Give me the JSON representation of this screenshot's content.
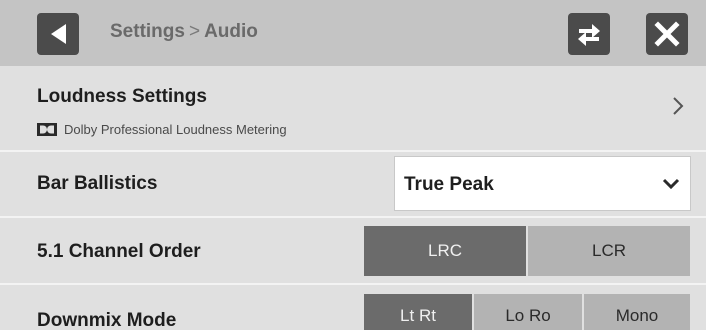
{
  "header": {
    "back_icon": "back-triangle-icon",
    "breadcrumb_parent": "Settings",
    "breadcrumb_separator": ">",
    "breadcrumb_current": "Audio",
    "swap_icon": "swap-arrows-icon",
    "close_icon": "close-x-icon"
  },
  "loudness": {
    "title": "Loudness Settings",
    "subtitle": "Dolby Professional Loudness Metering",
    "logo_icon": "dolby-logo-icon",
    "chevron_icon": "chevron-right-icon"
  },
  "bar_ballistics": {
    "label": "Bar Ballistics",
    "selected_value": "True Peak",
    "chevron_icon": "chevron-down-icon"
  },
  "channel_order": {
    "label": "5.1 Channel Order",
    "options": [
      "LRC",
      "LCR"
    ],
    "selected": "LRC"
  },
  "downmix": {
    "label": "Downmix Mode",
    "options": [
      "Lt Rt",
      "Lo Ro",
      "Mono"
    ],
    "selected": "Lt Rt"
  },
  "colors": {
    "header_bg": "#c4c4c4",
    "button_dark": "#4b4b4b",
    "row_bg": "#e0e0e0",
    "segment_selected": "#6b6b6b",
    "segment_unselected": "#b3b3b3"
  }
}
